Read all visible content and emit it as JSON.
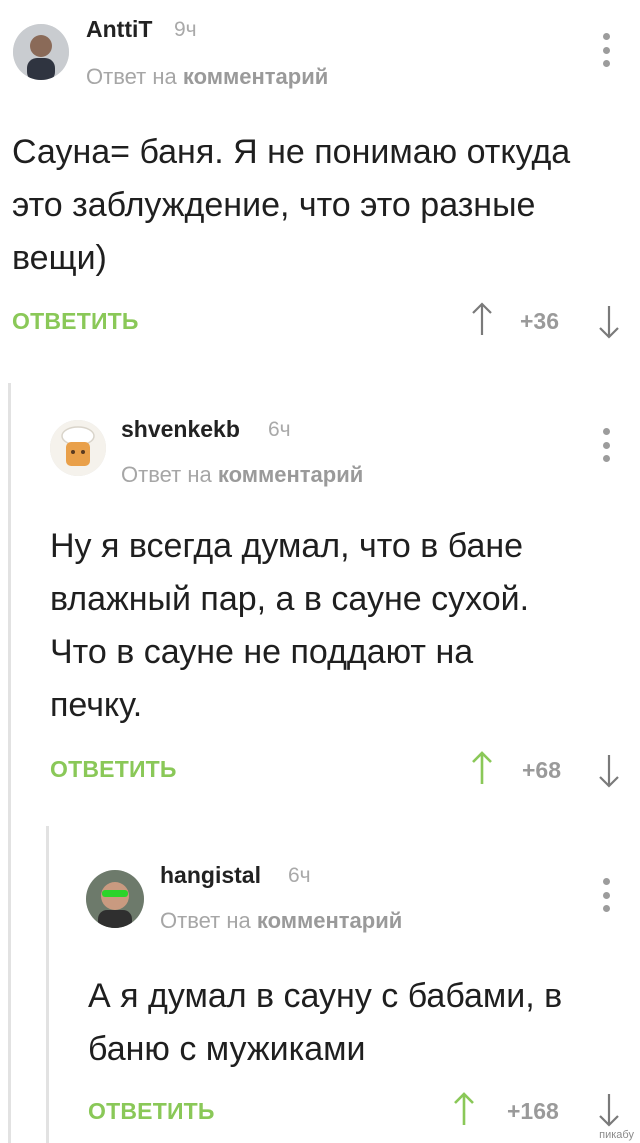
{
  "comments": [
    {
      "author": "AnttiT",
      "time": "9ч",
      "reply_prefix": "Ответ на",
      "reply_target": "комментарий",
      "text": "Сауна= баня. Я не понимаю откуда\nэто заблуждение, что это разные\nвещи)",
      "reply_label": "ОТВЕТИТЬ",
      "rating": "+36",
      "vote_up_color": "#7a7a7a"
    },
    {
      "author": "shvenkekb",
      "time": "6ч",
      "reply_prefix": "Ответ на",
      "reply_target": "комментарий",
      "text": "Ну я всегда думал, что в бане\nвлажный пар, а в сауне сухой.\nЧто в сауне не поддают на\nпечку.",
      "reply_label": "ОТВЕТИТЬ",
      "rating": "+68",
      "vote_up_color": "#8ac858"
    },
    {
      "author": "hangistal",
      "time": "6ч",
      "reply_prefix": "Ответ на",
      "reply_target": "комментарий",
      "text": "А я думал в сауну с бабами, в\nбаню с мужиками",
      "reply_label": "ОТВЕТИТЬ",
      "rating": "+168",
      "vote_up_color": "#8ac858"
    }
  ],
  "colors": {
    "accent": "#8ac858",
    "muted": "#a6a6a6",
    "thread_line": "#e2e2e2"
  },
  "icons": {
    "more": "kebab-menu-icon",
    "up": "arrow-up-icon",
    "down": "arrow-down-icon"
  },
  "watermark": "пикабу"
}
